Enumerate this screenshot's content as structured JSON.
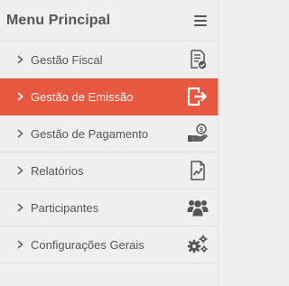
{
  "header": {
    "title": "Menu Principal",
    "menu_icon": "hamburger-icon"
  },
  "colors": {
    "accent": "#e8573f",
    "text": "#555555",
    "background": "#efefef"
  },
  "items": [
    {
      "label": "Gestão Fiscal",
      "icon": "document-check-icon",
      "active": false
    },
    {
      "label": "Gestão de Emissão",
      "icon": "export-document-icon",
      "active": true
    },
    {
      "label": "Gestão de Pagamento",
      "icon": "payment-hand-icon",
      "active": false
    },
    {
      "label": "Relatórios",
      "icon": "report-chart-icon",
      "active": false
    },
    {
      "label": "Participantes",
      "icon": "users-group-icon",
      "active": false
    },
    {
      "label": "Configurações Gerais",
      "icon": "gears-icon",
      "active": false
    }
  ]
}
